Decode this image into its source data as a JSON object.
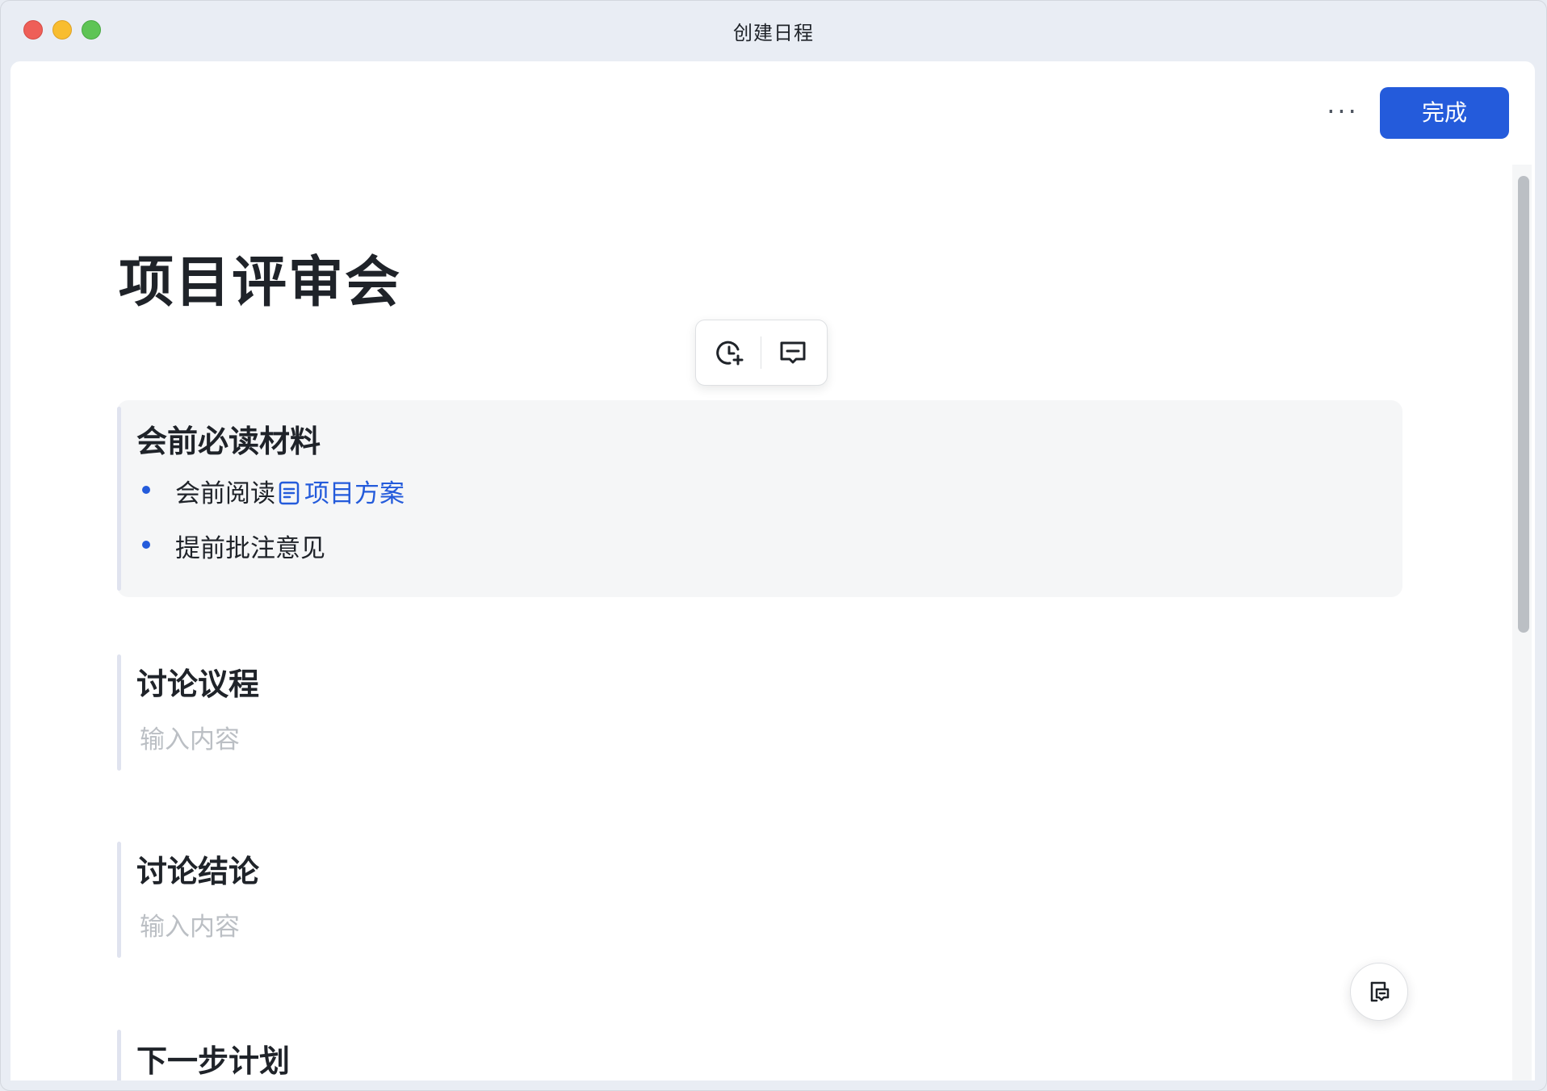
{
  "window": {
    "title": "创建日程"
  },
  "header": {
    "more_label": "···",
    "done_label": "完成"
  },
  "document": {
    "title": "项目评审会",
    "floating_toolbar": [
      {
        "icon": "clock-plus-icon"
      },
      {
        "icon": "comment-icon"
      }
    ],
    "sections": [
      {
        "title": "会前必读材料",
        "items": [
          {
            "text": "会前阅读",
            "link": "项目方案",
            "link_icon": "document-icon"
          },
          {
            "text": "提前批注意见"
          }
        ]
      },
      {
        "title": "讨论议程",
        "placeholder": "输入内容"
      },
      {
        "title": "讨论结论",
        "placeholder": "输入内容"
      },
      {
        "title": "下一步计划"
      }
    ]
  },
  "fab": {
    "icon": "doc-comment-icon"
  },
  "colors": {
    "accent": "#245bdb",
    "placeholder": "#bbbfc4",
    "callout_bg": "#f5f6f7"
  }
}
